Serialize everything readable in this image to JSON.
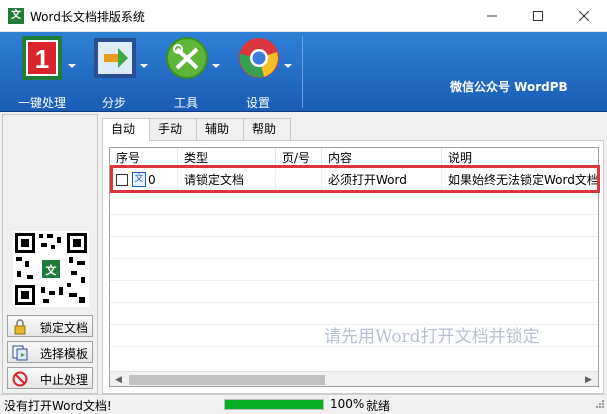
{
  "window": {
    "title": "Word长文档排版系统",
    "icon_text": "文",
    "controls": [
      "minimize-icon",
      "maximize-icon",
      "close-icon"
    ]
  },
  "toolbar": {
    "items": [
      {
        "label": "一键处理",
        "icon": "one-icon"
      },
      {
        "label": "分步",
        "icon": "step-arrow-icon"
      },
      {
        "label": "工具",
        "icon": "tools-icon"
      },
      {
        "label": "设置",
        "icon": "settings-globe-icon"
      }
    ],
    "brand": "微信公众号  WordPB"
  },
  "sidebar": {
    "qr_icon_text": "文",
    "buttons": [
      {
        "label": "锁定文档",
        "icon": "lock-icon"
      },
      {
        "label": "选择模板",
        "icon": "template-icon"
      },
      {
        "label": "中止处理",
        "icon": "stop-icon"
      }
    ]
  },
  "tabs": [
    "自动",
    "手动",
    "辅助",
    "帮助"
  ],
  "active_tab": "自动",
  "table": {
    "columns": [
      "序号",
      "类型",
      "页/号",
      "内容",
      "说明"
    ],
    "rows": [
      {
        "index": "0",
        "icon_text": "文",
        "type": "请锁定文档",
        "page": "",
        "content": "必须打开Word",
        "note": "如果始终无法锁定Word文档"
      }
    ],
    "watermark": "请先用Word打开文档并锁定"
  },
  "status": {
    "message": "没有打开Word文档!",
    "progress": 100,
    "progress_text": "100%",
    "state": "就绪"
  },
  "colors": {
    "toolbar": "#1f68c8",
    "highlight": "#d9363e",
    "progress": "#06b025"
  }
}
